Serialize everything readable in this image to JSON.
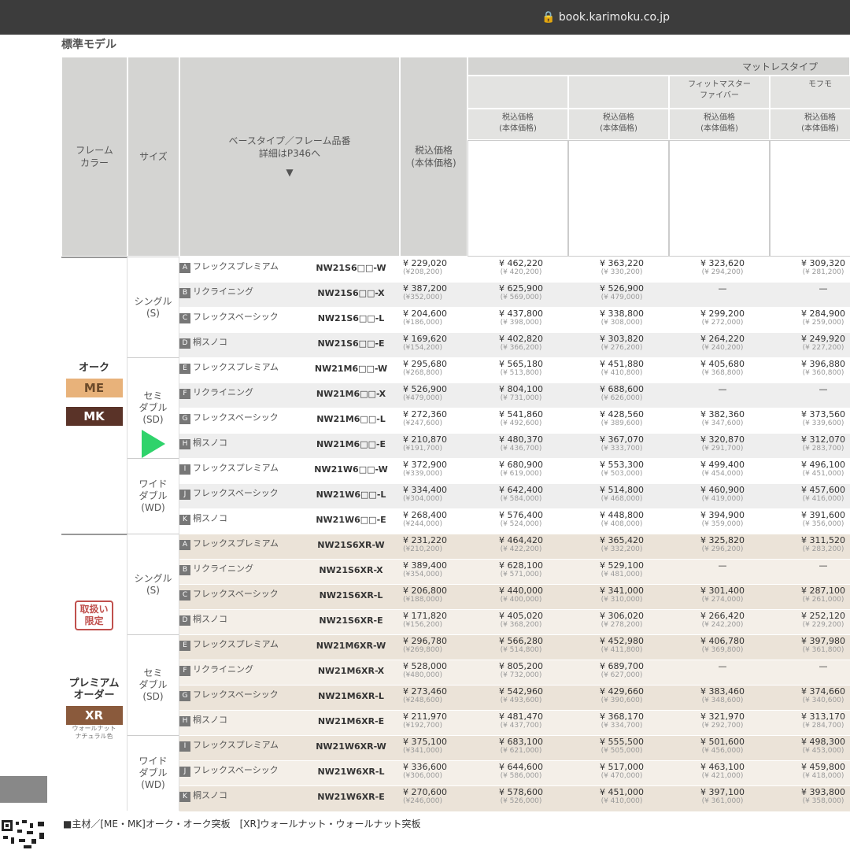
{
  "topbar": {
    "time": "",
    "url": "book.karimoku.co.jp"
  },
  "section_title": "標準モデル",
  "header": {
    "frame_color": "フレーム\nカラー",
    "size": "サイズ",
    "base_type": "ベースタイプ／フレーム品番\n詳細はP346へ",
    "price_col": "税込価格\n(本体価格)",
    "mattress_type": "マットレスタイプ",
    "mattress_cols": [
      {
        "name": "",
        "price_label": "税込価格\n(本体価格)",
        "spec": ""
      },
      {
        "name": "",
        "price_label": "税込価格\n(本体価格)",
        "spec": ""
      },
      {
        "name": "フィットマスター\nファイバー",
        "price_label": "税込価格\n(本体価格)",
        "spec": ""
      },
      {
        "name": "モフモ",
        "price_label": "税込価格\n(本体価格)",
        "spec": ""
      }
    ]
  },
  "groups": [
    {
      "frame": "オーク",
      "chips": [
        {
          "code": "ME",
          "note": "",
          "color": "#e8b27a",
          "text_color": "#6b4a2a"
        },
        {
          "code": "MK",
          "note": "",
          "color": "#5a3328",
          "text_color": "#ffffff"
        }
      ],
      "sizes": [
        {
          "label": "シングル\n(S)",
          "rows": [
            {
              "badge": "A",
              "name": "フレックスプレミアム",
              "model": "NW21S6□□-W",
              "base": [
                "¥ 229,020",
                "(¥208,200)"
              ],
              "m": [
                [
                  "¥ 462,220",
                  "(¥ 420,200)"
                ],
                [
                  "¥ 363,220",
                  "(¥ 330,200)"
                ],
                [
                  "¥ 323,620",
                  "(¥ 294,200)"
                ],
                [
                  "¥ 309,320",
                  "(¥ 281,200)"
                ]
              ]
            },
            {
              "badge": "B",
              "name": "リクライニング",
              "model": "NW21S6□□-X",
              "base": [
                "¥ 387,200",
                "(¥352,000)"
              ],
              "m": [
                [
                  "¥ 625,900",
                  "(¥ 569,000)"
                ],
                [
                  "¥ 526,900",
                  "(¥ 479,000)"
                ],
                [
                  "—",
                  ""
                ],
                [
                  "—",
                  ""
                ]
              ]
            },
            {
              "badge": "C",
              "name": "フレックスベーシック",
              "model": "NW21S6□□-L",
              "base": [
                "¥ 204,600",
                "(¥186,000)"
              ],
              "m": [
                [
                  "¥ 437,800",
                  "(¥ 398,000)"
                ],
                [
                  "¥ 338,800",
                  "(¥ 308,000)"
                ],
                [
                  "¥ 299,200",
                  "(¥ 272,000)"
                ],
                [
                  "¥ 284,900",
                  "(¥ 259,000)"
                ]
              ]
            },
            {
              "badge": "D",
              "name": "桐スノコ",
              "model": "NW21S6□□-E",
              "base": [
                "¥ 169,620",
                "(¥154,200)"
              ],
              "m": [
                [
                  "¥ 402,820",
                  "(¥ 366,200)"
                ],
                [
                  "¥ 303,820",
                  "(¥ 276,200)"
                ],
                [
                  "¥ 264,220",
                  "(¥ 240,200)"
                ],
                [
                  "¥ 249,920",
                  "(¥ 227,200)"
                ]
              ]
            }
          ]
        },
        {
          "label": "セミ\nダブル\n(SD)",
          "rows": [
            {
              "badge": "E",
              "name": "フレックスプレミアム",
              "model": "NW21M6□□-W",
              "base": [
                "¥ 295,680",
                "(¥268,800)"
              ],
              "m": [
                [
                  "¥ 565,180",
                  "(¥ 513,800)"
                ],
                [
                  "¥ 451,880",
                  "(¥ 410,800)"
                ],
                [
                  "¥ 405,680",
                  "(¥ 368,800)"
                ],
                [
                  "¥ 396,880",
                  "(¥ 360,800)"
                ]
              ]
            },
            {
              "badge": "F",
              "name": "リクライニング",
              "model": "NW21M6□□-X",
              "base": [
                "¥ 526,900",
                "(¥479,000)"
              ],
              "m": [
                [
                  "¥ 804,100",
                  "(¥ 731,000)"
                ],
                [
                  "¥ 688,600",
                  "(¥ 626,000)"
                ],
                [
                  "—",
                  ""
                ],
                [
                  "—",
                  ""
                ]
              ]
            },
            {
              "badge": "G",
              "name": "フレックスベーシック",
              "model": "NW21M6□□-L",
              "base": [
                "¥ 272,360",
                "(¥247,600)"
              ],
              "m": [
                [
                  "¥ 541,860",
                  "(¥ 492,600)"
                ],
                [
                  "¥ 428,560",
                  "(¥ 389,600)"
                ],
                [
                  "¥ 382,360",
                  "(¥ 347,600)"
                ],
                [
                  "¥ 373,560",
                  "(¥ 339,600)"
                ]
              ]
            },
            {
              "badge": "H",
              "name": "桐スノコ",
              "model": "NW21M6□□-E",
              "base": [
                "¥ 210,870",
                "(¥191,700)"
              ],
              "m": [
                [
                  "¥ 480,370",
                  "(¥ 436,700)"
                ],
                [
                  "¥ 367,070",
                  "(¥ 333,700)"
                ],
                [
                  "¥ 320,870",
                  "(¥ 291,700)"
                ],
                [
                  "¥ 312,070",
                  "(¥ 283,700)"
                ]
              ]
            }
          ]
        },
        {
          "label": "ワイド\nダブル\n(WD)",
          "rows": [
            {
              "badge": "I",
              "name": "フレックスプレミアム",
              "model": "NW21W6□□-W",
              "base": [
                "¥ 372,900",
                "(¥339,000)"
              ],
              "m": [
                [
                  "¥ 680,900",
                  "(¥ 619,000)"
                ],
                [
                  "¥ 553,300",
                  "(¥ 503,000)"
                ],
                [
                  "¥ 499,400",
                  "(¥ 454,000)"
                ],
                [
                  "¥ 496,100",
                  "(¥ 451,000)"
                ]
              ]
            },
            {
              "badge": "J",
              "name": "フレックスベーシック",
              "model": "NW21W6□□-L",
              "base": [
                "¥ 334,400",
                "(¥304,000)"
              ],
              "m": [
                [
                  "¥ 642,400",
                  "(¥ 584,000)"
                ],
                [
                  "¥ 514,800",
                  "(¥ 468,000)"
                ],
                [
                  "¥ 460,900",
                  "(¥ 419,000)"
                ],
                [
                  "¥ 457,600",
                  "(¥ 416,000)"
                ]
              ]
            },
            {
              "badge": "K",
              "name": "桐スノコ",
              "model": "NW21W6□□-E",
              "base": [
                "¥ 268,400",
                "(¥244,000)"
              ],
              "m": [
                [
                  "¥ 576,400",
                  "(¥ 524,000)"
                ],
                [
                  "¥ 448,800",
                  "(¥ 408,000)"
                ],
                [
                  "¥ 394,900",
                  "(¥ 359,000)"
                ],
                [
                  "¥ 391,600",
                  "(¥ 356,000)"
                ]
              ]
            }
          ]
        }
      ]
    },
    {
      "frame": "プレミアム\nオーダー",
      "tag": "取扱い\n限定",
      "chips": [
        {
          "code": "XR",
          "note": "ウォールナット\nナチュラル色",
          "color": "#8a5a3c",
          "text_color": "#ffffff"
        }
      ],
      "sizes": [
        {
          "label": "シングル\n(S)",
          "rows": [
            {
              "badge": "A",
              "name": "フレックスプレミアム",
              "model": "NW21S6XR-W",
              "base": [
                "¥ 231,220",
                "(¥210,200)"
              ],
              "m": [
                [
                  "¥ 464,420",
                  "(¥ 422,200)"
                ],
                [
                  "¥ 365,420",
                  "(¥ 332,200)"
                ],
                [
                  "¥ 325,820",
                  "(¥ 296,200)"
                ],
                [
                  "¥ 311,520",
                  "(¥ 283,200)"
                ]
              ]
            },
            {
              "badge": "B",
              "name": "リクライニング",
              "model": "NW21S6XR-X",
              "base": [
                "¥ 389,400",
                "(¥354,000)"
              ],
              "m": [
                [
                  "¥ 628,100",
                  "(¥ 571,000)"
                ],
                [
                  "¥ 529,100",
                  "(¥ 481,000)"
                ],
                [
                  "—",
                  ""
                ],
                [
                  "—",
                  ""
                ]
              ]
            },
            {
              "badge": "C",
              "name": "フレックスベーシック",
              "model": "NW21S6XR-L",
              "base": [
                "¥ 206,800",
                "(¥188,000)"
              ],
              "m": [
                [
                  "¥ 440,000",
                  "(¥ 400,000)"
                ],
                [
                  "¥ 341,000",
                  "(¥ 310,000)"
                ],
                [
                  "¥ 301,400",
                  "(¥ 274,000)"
                ],
                [
                  "¥ 287,100",
                  "(¥ 261,000)"
                ]
              ]
            },
            {
              "badge": "D",
              "name": "桐スノコ",
              "model": "NW21S6XR-E",
              "base": [
                "¥ 171,820",
                "(¥156,200)"
              ],
              "m": [
                [
                  "¥ 405,020",
                  "(¥ 368,200)"
                ],
                [
                  "¥ 306,020",
                  "(¥ 278,200)"
                ],
                [
                  "¥ 266,420",
                  "(¥ 242,200)"
                ],
                [
                  "¥ 252,120",
                  "(¥ 229,200)"
                ]
              ]
            }
          ]
        },
        {
          "label": "セミ\nダブル\n(SD)",
          "rows": [
            {
              "badge": "E",
              "name": "フレックスプレミアム",
              "model": "NW21M6XR-W",
              "base": [
                "¥ 296,780",
                "(¥269,800)"
              ],
              "m": [
                [
                  "¥ 566,280",
                  "(¥ 514,800)"
                ],
                [
                  "¥ 452,980",
                  "(¥ 411,800)"
                ],
                [
                  "¥ 406,780",
                  "(¥ 369,800)"
                ],
                [
                  "¥ 397,980",
                  "(¥ 361,800)"
                ]
              ]
            },
            {
              "badge": "F",
              "name": "リクライニング",
              "model": "NW21M6XR-X",
              "base": [
                "¥ 528,000",
                "(¥480,000)"
              ],
              "m": [
                [
                  "¥ 805,200",
                  "(¥ 732,000)"
                ],
                [
                  "¥ 689,700",
                  "(¥ 627,000)"
                ],
                [
                  "—",
                  ""
                ],
                [
                  "—",
                  ""
                ]
              ]
            },
            {
              "badge": "G",
              "name": "フレックスベーシック",
              "model": "NW21M6XR-L",
              "base": [
                "¥ 273,460",
                "(¥248,600)"
              ],
              "m": [
                [
                  "¥ 542,960",
                  "(¥ 493,600)"
                ],
                [
                  "¥ 429,660",
                  "(¥ 390,600)"
                ],
                [
                  "¥ 383,460",
                  "(¥ 348,600)"
                ],
                [
                  "¥ 374,660",
                  "(¥ 340,600)"
                ]
              ]
            },
            {
              "badge": "H",
              "name": "桐スノコ",
              "model": "NW21M6XR-E",
              "base": [
                "¥ 211,970",
                "(¥192,700)"
              ],
              "m": [
                [
                  "¥ 481,470",
                  "(¥ 437,700)"
                ],
                [
                  "¥ 368,170",
                  "(¥ 334,700)"
                ],
                [
                  "¥ 321,970",
                  "(¥ 292,700)"
                ],
                [
                  "¥ 313,170",
                  "(¥ 284,700)"
                ]
              ]
            }
          ]
        },
        {
          "label": "ワイド\nダブル\n(WD)",
          "rows": [
            {
              "badge": "I",
              "name": "フレックスプレミアム",
              "model": "NW21W6XR-W",
              "base": [
                "¥ 375,100",
                "(¥341,000)"
              ],
              "m": [
                [
                  "¥ 683,100",
                  "(¥ 621,000)"
                ],
                [
                  "¥ 555,500",
                  "(¥ 505,000)"
                ],
                [
                  "¥ 501,600",
                  "(¥ 456,000)"
                ],
                [
                  "¥ 498,300",
                  "(¥ 453,000)"
                ]
              ]
            },
            {
              "badge": "J",
              "name": "フレックスベーシック",
              "model": "NW21W6XR-L",
              "base": [
                "¥ 336,600",
                "(¥306,000)"
              ],
              "m": [
                [
                  "¥ 644,600",
                  "(¥ 586,000)"
                ],
                [
                  "¥ 517,000",
                  "(¥ 470,000)"
                ],
                [
                  "¥ 463,100",
                  "(¥ 421,000)"
                ],
                [
                  "¥ 459,800",
                  "(¥ 418,000)"
                ]
              ]
            },
            {
              "badge": "K",
              "name": "桐スノコ",
              "model": "NW21W6XR-E",
              "base": [
                "¥ 270,600",
                "(¥246,000)"
              ],
              "m": [
                [
                  "¥ 578,600",
                  "(¥ 526,000)"
                ],
                [
                  "¥ 451,000",
                  "(¥ 410,000)"
                ],
                [
                  "¥ 397,100",
                  "(¥ 361,000)"
                ],
                [
                  "¥ 393,800",
                  "(¥ 358,000)"
                ]
              ]
            }
          ]
        }
      ]
    }
  ],
  "notes": [
    "■主材／[ME・MK]オーク・オーク突板　[XR]ウォールナット・ウォールナット突板",
    ""
  ],
  "qr_label": ""
}
